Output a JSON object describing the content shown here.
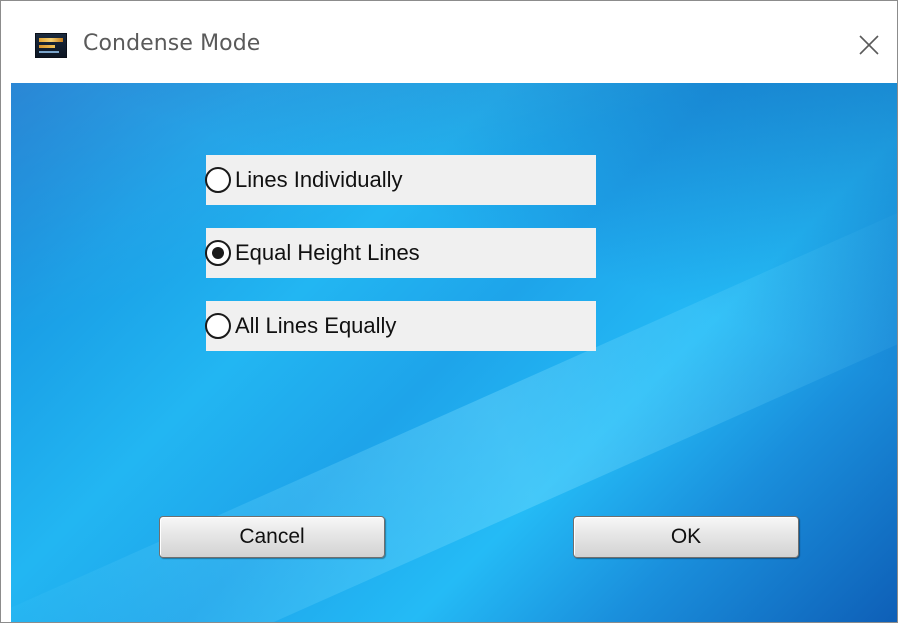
{
  "window": {
    "title": "Condense Mode",
    "app_icon": "app-logo-icon",
    "close_icon": "close-icon"
  },
  "options": [
    {
      "label": "Lines Individually",
      "checked": false
    },
    {
      "label": "Equal Height Lines",
      "checked": true
    },
    {
      "label": "All Lines Equally",
      "checked": false
    }
  ],
  "buttons": {
    "cancel_label": "Cancel",
    "ok_label": "OK"
  },
  "colors": {
    "background_gradient_start": "#1279d0",
    "background_gradient_mid": "#22b6f2",
    "background_gradient_end": "#0e5fb7",
    "option_background": "#f0f0f0"
  }
}
